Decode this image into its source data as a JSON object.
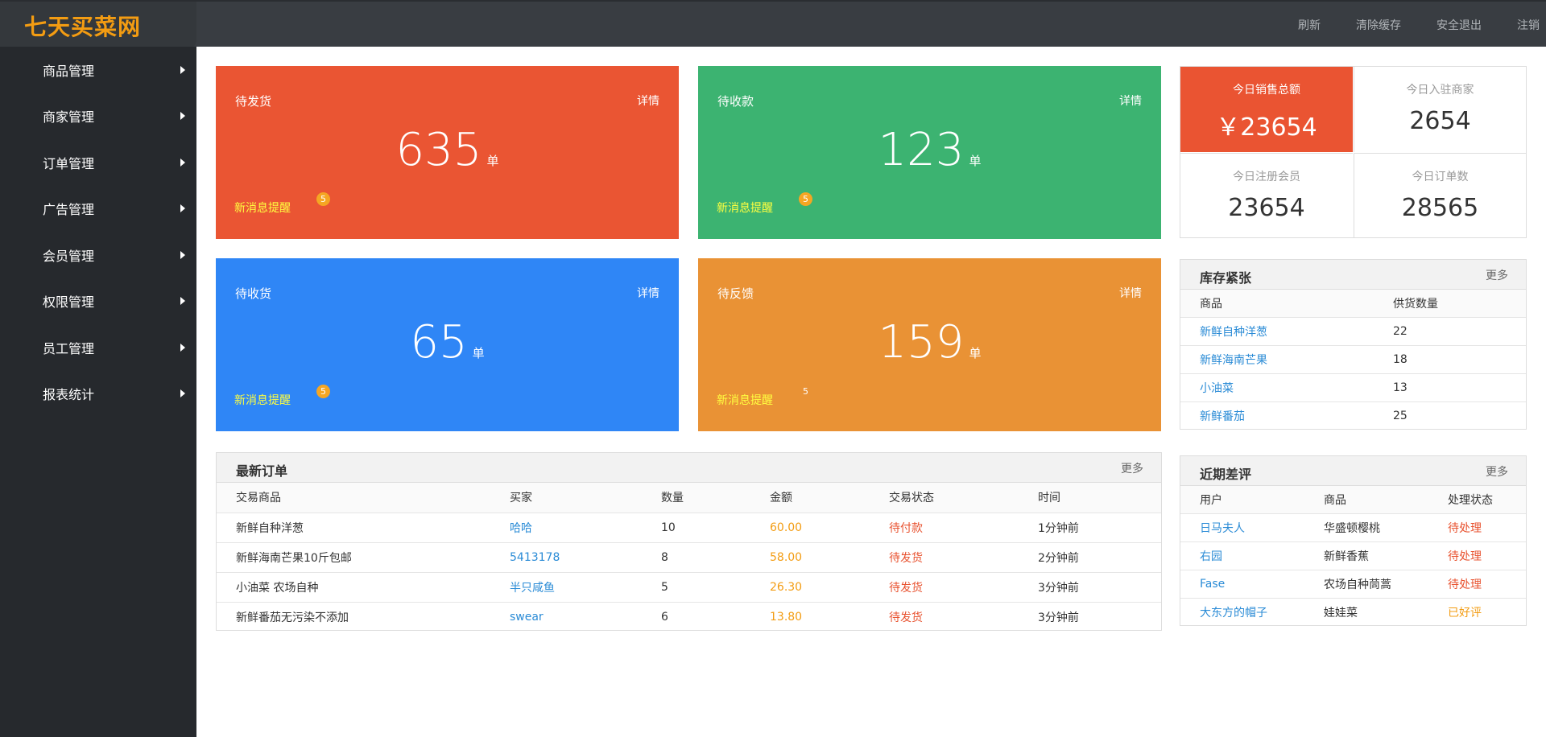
{
  "header": {
    "logo": "七天买菜网",
    "links": [
      "刷新",
      "清除缓存",
      "安全退出",
      "注销"
    ]
  },
  "sidebar": {
    "items": [
      "商品管理",
      "商家管理",
      "订单管理",
      "广告管理",
      "会员管理",
      "权限管理",
      "员工管理",
      "报表统计"
    ]
  },
  "cards": [
    {
      "title": "待发货",
      "detail": "详情",
      "value": "635",
      "unit": "单",
      "msg": "新消息提醒",
      "badge": "5",
      "color": "#ea5533"
    },
    {
      "title": "待收款",
      "detail": "详情",
      "value": "123",
      "unit": "单",
      "msg": "新消息提醒",
      "badge": "5",
      "color": "#3cb371"
    },
    {
      "title": "待收货",
      "detail": "详情",
      "value": "65",
      "unit": "单",
      "msg": "新消息提醒",
      "badge": "5",
      "color": "#2f86f6"
    },
    {
      "title": "待反馈",
      "detail": "详情",
      "value": "159",
      "unit": "单",
      "msg": "新消息提醒",
      "badge": "5",
      "color": "#e99235"
    }
  ],
  "stats": [
    {
      "label": "今日销售总额",
      "value": "￥23654"
    },
    {
      "label": "今日入驻商家",
      "value": "2654"
    },
    {
      "label": "今日注册会员",
      "value": "23654"
    },
    {
      "label": "今日订单数",
      "value": "28565"
    }
  ],
  "orders": {
    "title": "最新订单",
    "more": "更多",
    "columns": [
      "交易商品",
      "买家",
      "数量",
      "金额",
      "交易状态",
      "时间"
    ],
    "rows": [
      [
        "新鲜自种洋葱",
        "哈哈",
        "10",
        "60.00",
        "待付款",
        "1分钟前"
      ],
      [
        "新鲜海南芒果10斤包邮",
        "5413178",
        "8",
        "58.00",
        "待发货",
        "2分钟前"
      ],
      [
        "小油菜 农场自种",
        "半只咸鱼",
        "5",
        "26.30",
        "待发货",
        "3分钟前"
      ],
      [
        "新鲜番茄无污染不添加",
        "swear",
        "6",
        "13.80",
        "待发货",
        "3分钟前"
      ]
    ]
  },
  "stock": {
    "title": "库存紧张",
    "more": "更多",
    "columns": [
      "商品",
      "供货数量"
    ],
    "rows": [
      [
        "新鲜自种洋葱",
        "22"
      ],
      [
        "新鲜海南芒果",
        "18"
      ],
      [
        "小油菜",
        "13"
      ],
      [
        "新鲜番茄",
        "25"
      ]
    ]
  },
  "reviews": {
    "title": "近期差评",
    "more": "更多",
    "columns": [
      "用户",
      "商品",
      "处理状态"
    ],
    "rows": [
      [
        "日马夫人",
        "华盛顿樱桃",
        "待处理"
      ],
      [
        "右园",
        "新鲜香蕉",
        "待处理"
      ],
      [
        "Fase",
        "农场自种茼蒿",
        "待处理"
      ],
      [
        "大东方的帽子",
        "娃娃菜",
        "已好评"
      ]
    ]
  }
}
